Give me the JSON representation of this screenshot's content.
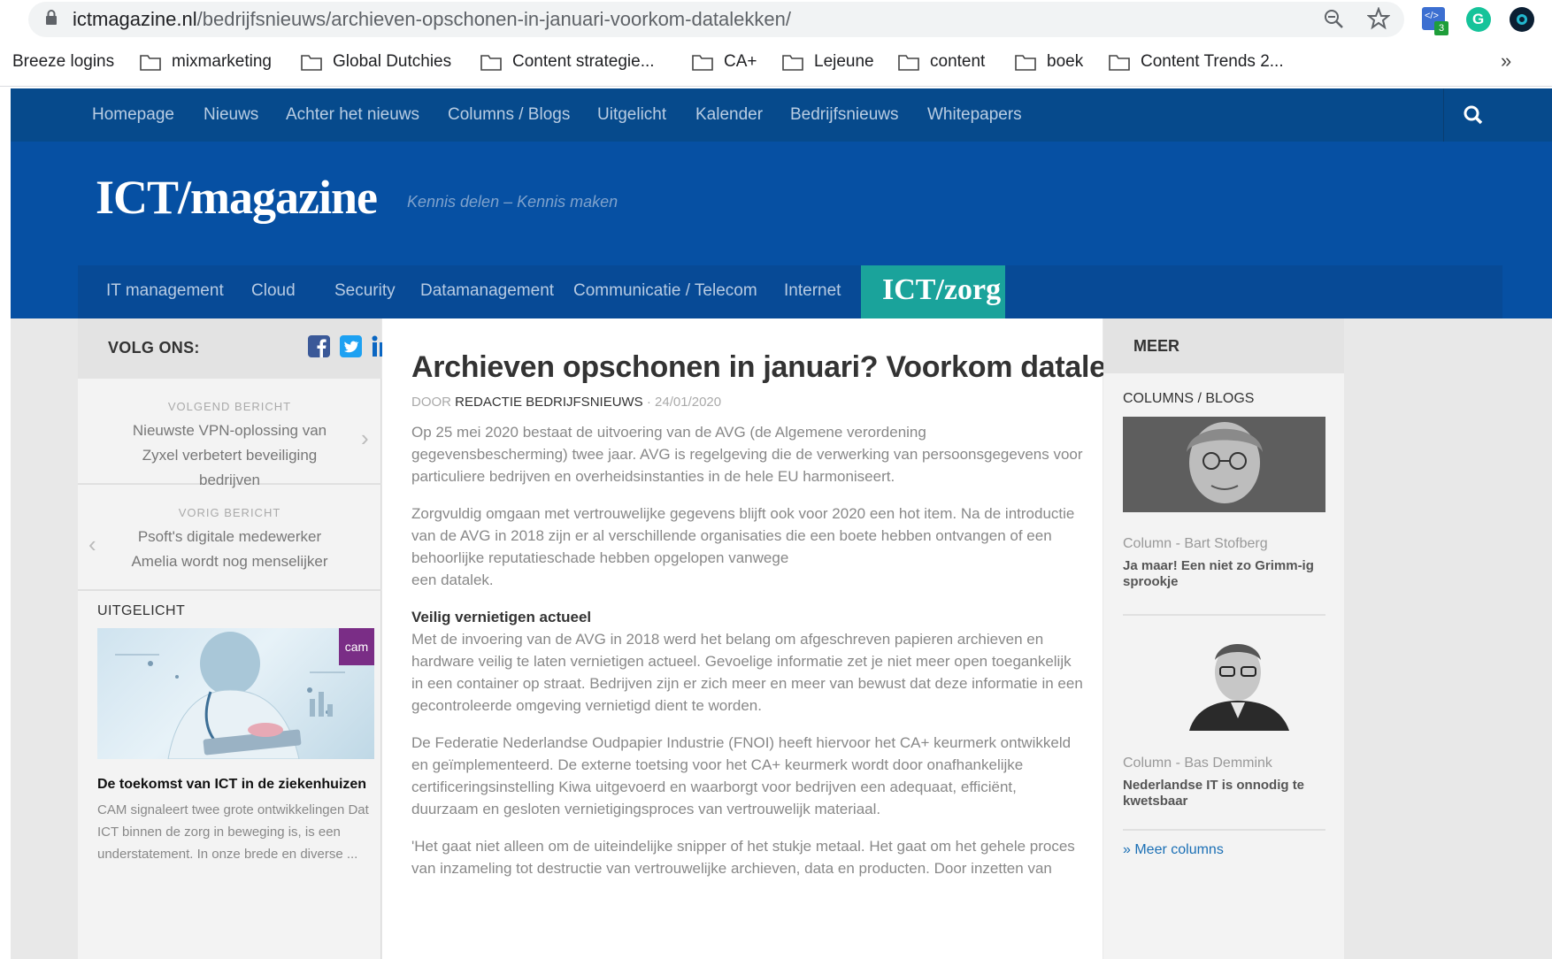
{
  "browser": {
    "url_host": "ictmagazine.nl",
    "url_path": "/bedrijfsnieuws/archieven-opschonen-in-januari-voorkom-datalekken/",
    "extension_badge": "3",
    "bookmarks": [
      {
        "label": "Breeze logins",
        "folder": false
      },
      {
        "label": "mixmarketing",
        "folder": true
      },
      {
        "label": "Global Dutchies",
        "folder": true
      },
      {
        "label": "Content strategie...",
        "folder": true
      },
      {
        "label": "CA+",
        "folder": true
      },
      {
        "label": "Lejeune",
        "folder": true
      },
      {
        "label": "content",
        "folder": true
      },
      {
        "label": "boek",
        "folder": true
      },
      {
        "label": "Content Trends 2...",
        "folder": true
      }
    ],
    "bookmarks_more": "»"
  },
  "site": {
    "topnav": [
      "Homepage",
      "Nieuws",
      "Achter het nieuws",
      "Columns / Blogs",
      "Uitgelicht",
      "Kalender",
      "Bedrijfsnieuws",
      "Whitepapers"
    ],
    "logo": "ICT/magazine",
    "tagline": "Kennis delen – Kennis maken",
    "categories": [
      "IT management",
      "Cloud",
      "Security",
      "Datamanagement",
      "Communicatie / Telecom",
      "Internet"
    ],
    "category_zorg": "ICT/zorg"
  },
  "left_sidebar": {
    "follow_label": "VOLG ONS:",
    "next_kicker": "VOLGEND BERICHT",
    "next_title": "Nieuwste VPN-oplossing van Zyxel verbetert beveiliging bedrijven",
    "prev_kicker": "VORIG BERICHT",
    "prev_title": "Psoft's digitale medewerker Amelia wordt nog menselijker",
    "featured_label": "UITGELICHT",
    "featured_brand": "cam",
    "featured_title": "De toekomst van ICT in de ziekenhuizen",
    "featured_excerpt": "CAM signaleert twee grote ontwikkelingen Dat ICT binnen de zorg in beweging is, is een understatement. In onze brede en diverse ..."
  },
  "article": {
    "title": "Archieven opschonen in januari? Voorkom datalekken!",
    "by_prefix": "DOOR",
    "author": "REDACTIE BEDRIJFSNIEUWS",
    "date": "· 24/01/2020",
    "p1": "Op 25 mei 2020 bestaat de uitvoering van de AVG (de Algemene verordening gegevensbescherming) twee jaar. AVG is regelgeving die de verwerking van persoonsgegevens voor particuliere bedrijven en overheidsinstanties in de hele EU harmoniseert.",
    "p2": "Zorgvuldig omgaan met vertrouwelijke gegevens blijft ook voor 2020 een hot item. Na de introductie van de AVG in 2018 zijn er al verschillende organisaties die een boete hebben ontvangen of een behoorlijke reputatieschade hebben opgelopen vanwege",
    "p2b": "een datalek.",
    "h1": "Veilig vernietigen actueel",
    "p3": "Met de invoering van de AVG in 2018 werd het belang om afgeschreven papieren archieven en hardware veilig te laten vernietigen actueel. Gevoelige informatie zet je niet meer open toegankelijk in een container op straat. Bedrijven zijn er zich meer en meer van bewust dat deze informatie in een gecontroleerde omgeving vernietigd dient te worden.",
    "p4": "De Federatie Nederlandse Oudpapier Industrie (FNOI) heeft hiervoor het CA+ keurmerk ontwikkeld en geïmplementeerd. De externe toetsing voor het CA+ keurmerk wordt door onafhankelijke certificeringsinstelling Kiwa uitgevoerd en waarborgt voor bedrijven een adequaat, efficiënt, duurzaam en gesloten vernietigingsproces van vertrouwelijk materiaal.",
    "p5": "'Het gaat niet alleen om de uiteindelijke snipper of het stukje metaal. Het gaat om het gehele proces van inzameling tot destructie van vertrouwelijke archieven, data en producten. Door inzetten van"
  },
  "right_sidebar": {
    "label": "MEER",
    "section": "COLUMNS / BLOGS",
    "col1_kicker": "Column - Bart Stofberg",
    "col1_title": "Ja maar! Een niet zo Grimm-ig sprookje",
    "col2_kicker": "Column - Bas Demmink",
    "col2_title": "Nederlandse IT is onnodig te kwetsbaar",
    "more": "» Meer columns"
  },
  "colors": {
    "topnav": "#064a8c",
    "header": "#0650a3",
    "zorg": "#1aa39b",
    "link": "#1a6fb5"
  }
}
